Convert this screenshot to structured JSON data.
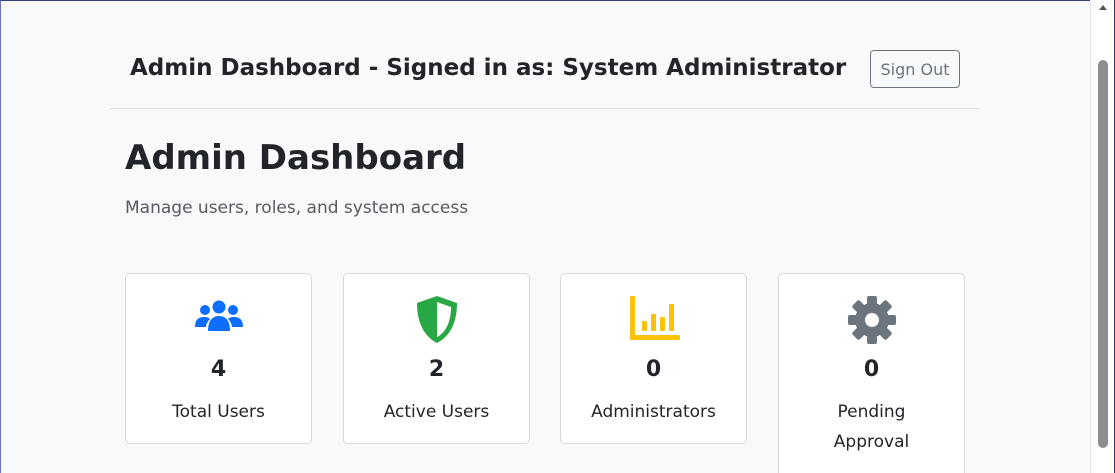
{
  "header": {
    "title": "Admin Dashboard - Signed in as: System Administrator",
    "signout_label": "Sign Out"
  },
  "page": {
    "title": "Admin Dashboard",
    "subtitle": "Manage users, roles, and system access"
  },
  "stats": [
    {
      "icon": "users-icon",
      "color": "#0d6efd",
      "value": "4",
      "label": "Total Users"
    },
    {
      "icon": "shield-icon",
      "color": "#28a745",
      "value": "2",
      "label": "Active Users"
    },
    {
      "icon": "chart-icon",
      "color": "#ffc107",
      "value": "0",
      "label": "Administrators"
    },
    {
      "icon": "gear-icon",
      "color": "#6c757d",
      "value": "0",
      "label": "Pending Approval"
    }
  ]
}
